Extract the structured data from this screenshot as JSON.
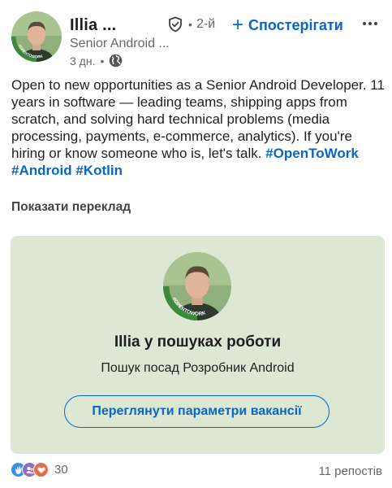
{
  "author": {
    "name": "Illia ...",
    "degree": "2-й",
    "separator": "•",
    "headline": "Senior Android ...",
    "time": "3 дн.",
    "time_separator": "•",
    "avatar_badge_text": "#OPENTOWORK"
  },
  "follow": {
    "label": "Спостерігати",
    "plus": "+"
  },
  "post": {
    "text": "Open to new opportunities as a Senior Android Developer. 11 years in software — leading teams, shipping apps from scratch, and solving hard technical problems (media processing, payments, e-commerce, analytics). If you're hiring or know someone who is, let's talk. ",
    "hashtags": [
      "#OpenToWork",
      "#Android",
      "#Kotlin"
    ],
    "translate_label": "Показати переклад"
  },
  "open_to_work_card": {
    "title": "Illia у пошуках роботи",
    "subtitle": "Пошук посад Розробник Android",
    "button_label": "Переглянути параметри вакансії",
    "badge_text": "#OPENTOWORK"
  },
  "social": {
    "reaction_count": "30",
    "reposts_label": "11 репостів"
  },
  "colors": {
    "accent": "#0a66c2",
    "card_bg": "#dce8d4",
    "opentowork_green": "#3c8a3c"
  }
}
